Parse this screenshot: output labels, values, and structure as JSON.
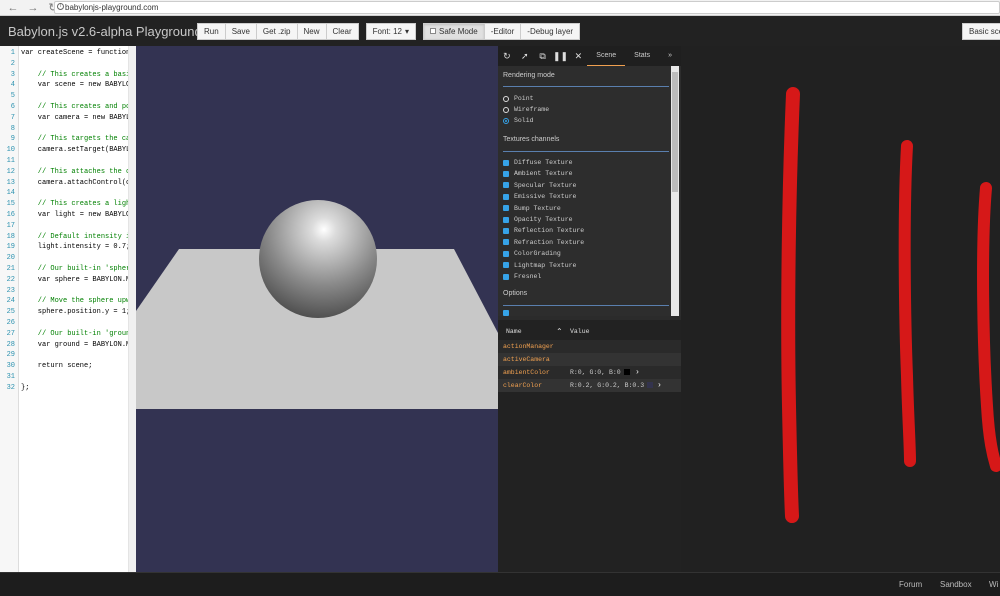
{
  "browser": {
    "url": "babylonjs-playground.com",
    "back_icon": "arrow-left-icon",
    "forward_icon": "arrow-right-icon",
    "reload_icon": "reload-icon"
  },
  "topbar": {
    "title": "Babylon.js v2.6-alpha Playground",
    "buttons": {
      "run": "Run",
      "save": "Save",
      "getzip": "Get .zip",
      "new": "New",
      "clear": "Clear"
    },
    "font": "Font: 12",
    "safe_mode": "Safe Mode",
    "editor_toggle": "-Editor",
    "debug_toggle": "-Debug layer",
    "basic_scene": "Basic sce"
  },
  "editor": {
    "lines": [
      {
        "n": "1",
        "code": "var createScene = function"
      },
      {
        "n": "2",
        "code": ""
      },
      {
        "n": "3",
        "code": "    // This creates a basic"
      },
      {
        "n": "4",
        "code": "    var scene = new BABYLON"
      },
      {
        "n": "5",
        "code": ""
      },
      {
        "n": "6",
        "code": "    // This creates and po"
      },
      {
        "n": "7",
        "code": "    var camera = new BABYL"
      },
      {
        "n": "8",
        "code": ""
      },
      {
        "n": "9",
        "code": "    // This targets the ca"
      },
      {
        "n": "10",
        "code": "    camera.setTarget(BABYL"
      },
      {
        "n": "11",
        "code": ""
      },
      {
        "n": "12",
        "code": "    // This attaches the c"
      },
      {
        "n": "13",
        "code": "    camera.attachControl(c"
      },
      {
        "n": "14",
        "code": ""
      },
      {
        "n": "15",
        "code": "    // This creates a light"
      },
      {
        "n": "16",
        "code": "    var light = new BABYLO"
      },
      {
        "n": "17",
        "code": ""
      },
      {
        "n": "18",
        "code": "    // Default intensity i"
      },
      {
        "n": "19",
        "code": "    light.intensity = 0.7;"
      },
      {
        "n": "20",
        "code": ""
      },
      {
        "n": "21",
        "code": "    // Our built-in 'spher"
      },
      {
        "n": "22",
        "code": "    var sphere = BABYLON.M"
      },
      {
        "n": "23",
        "code": ""
      },
      {
        "n": "24",
        "code": "    // Move the sphere upw"
      },
      {
        "n": "25",
        "code": "    sphere.position.y = 1;"
      },
      {
        "n": "26",
        "code": ""
      },
      {
        "n": "27",
        "code": "    // Our built-in 'groun"
      },
      {
        "n": "28",
        "code": "    var ground = BABYLON.M"
      },
      {
        "n": "29",
        "code": ""
      },
      {
        "n": "30",
        "code": "    return scene;"
      },
      {
        "n": "31",
        "code": ""
      },
      {
        "n": "32",
        "code": "};"
      }
    ]
  },
  "debug": {
    "tool_icons": [
      "refresh-icon",
      "cursor-icon",
      "popout-icon",
      "pause-icon",
      "close-icon"
    ],
    "tabs": {
      "scene": "Scene",
      "stats": "Stats",
      "more": "»"
    },
    "rendering_mode": {
      "title": "Rendering mode",
      "options": [
        "Point",
        "Wireframe",
        "Solid"
      ],
      "selected": "Solid"
    },
    "textures": {
      "title": "Textures channels",
      "items": [
        "Diffuse Texture",
        "Ambient Texture",
        "Specular Texture",
        "Emissive Texture",
        "Bump Texture",
        "Opacity Texture",
        "Reflection Texture",
        "Refraction Texture",
        "ColorGrading",
        "Lightmap Texture",
        "Fresnel"
      ]
    },
    "options_title": "Options",
    "table": {
      "col_name": "Name",
      "col_value": "Value",
      "rows": [
        {
          "name": "actionManager",
          "value": ""
        },
        {
          "name": "activeCamera",
          "value": ""
        },
        {
          "name": "ambientColor",
          "value": "R:0, G:0, B:0",
          "swatch": "#000000"
        },
        {
          "name": "clearColor",
          "value": "R:0.2, G:0.2, B:0.3",
          "swatch": "#33334d"
        }
      ]
    }
  },
  "colors": {
    "accent": "#f0a050",
    "checkbox": "#36a3e8",
    "scene_bg": "#333352",
    "annotation": "#e01818"
  },
  "footer": {
    "forum": "Forum",
    "sandbox": "Sandbox",
    "wiki": "Wi"
  }
}
